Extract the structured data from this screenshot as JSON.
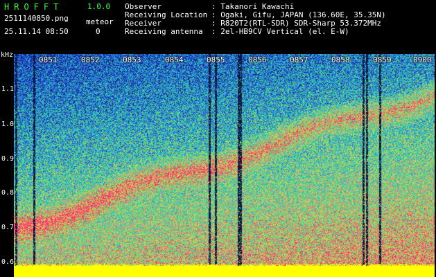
{
  "header": {
    "app_name": "HROFFT",
    "version": "1.0.0",
    "filename": "2511140850.png",
    "datetime": "25.11.14 08:50",
    "meteor_label": "meteor",
    "meteor_count": "0"
  },
  "info": [
    {
      "key": "Observer",
      "value": ": Takanori Kawachi"
    },
    {
      "key": "Receiving Location",
      "value": ": Ogaki, Gifu, JAPAN (136.60E, 35.35N)"
    },
    {
      "key": "Receiver",
      "value": ": R820T2(RTL-SDR) SDR-Sharp 53.372MHz"
    },
    {
      "key": "Receiving antenna",
      "value": ": 2el-HB9CV Vertical (el. E-W)"
    }
  ],
  "axis": {
    "unit": "kHz",
    "freq_labels": [
      "1.1",
      "1.0",
      "0.9",
      "0.8",
      "0.7",
      "0.6"
    ],
    "time_labels": [
      "0851",
      "0852",
      "0853",
      "0854",
      "0855",
      "0856",
      "0857",
      "0858",
      "0859",
      "0900"
    ]
  },
  "colors": {
    "header_green": "#39ff39",
    "noise_low": "#1a2a9a",
    "noise_mid": "#2ed3c8",
    "noise_high": "#ff2a6a",
    "baseline": "#ffff00"
  }
}
